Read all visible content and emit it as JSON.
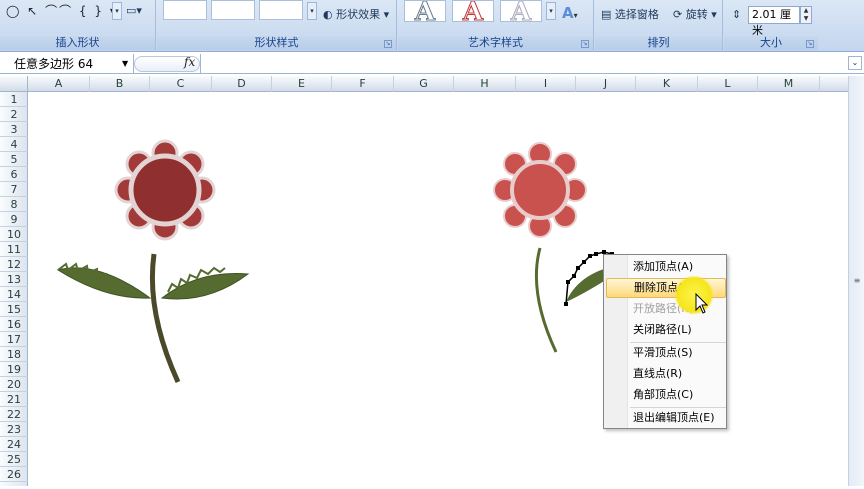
{
  "ribbon": {
    "groups": [
      {
        "label": "插入形状"
      },
      {
        "label": "形状样式"
      },
      {
        "label": "艺术字样式"
      },
      {
        "label": "排列"
      },
      {
        "label": "大小"
      }
    ],
    "shape_effects_label": "形状效果",
    "selection_pane_label": "选择窗格",
    "rotate_label": "旋转",
    "wordart_letter": "A",
    "size_value": "2.01 厘米"
  },
  "formula_bar": {
    "name_box": "任意多边形  64",
    "fx_label": "fx",
    "formula": ""
  },
  "columns": [
    "A",
    "B",
    "C",
    "D",
    "E",
    "F",
    "G",
    "H",
    "I",
    "J",
    "K",
    "L",
    "M"
  ],
  "rows": [
    "1",
    "2",
    "3",
    "4",
    "5",
    "6",
    "7",
    "8",
    "9",
    "10",
    "11",
    "12",
    "13",
    "14",
    "15",
    "16",
    "17",
    "18",
    "19",
    "20",
    "21",
    "22",
    "23",
    "24",
    "25",
    "26"
  ],
  "context_menu": {
    "items": [
      {
        "label": "添加顶点(A)",
        "state": "normal"
      },
      {
        "label": "删除顶点(L)",
        "state": "hover"
      },
      {
        "label": "开放路径(N)",
        "state": "disabled"
      },
      {
        "label": "关闭路径(L)",
        "state": "normal"
      },
      {
        "label": "平滑顶点(S)",
        "state": "normal"
      },
      {
        "label": "直线点(R)",
        "state": "normal"
      },
      {
        "label": "角部顶点(C)",
        "state": "normal"
      },
      {
        "label": "退出编辑顶点(E)",
        "state": "normal"
      }
    ]
  },
  "colors": {
    "flower_left_center": "#8f2f2f",
    "flower_left_petal": "#a33a3a",
    "flower_right": "#c9524f",
    "leaf": "#556b2f",
    "stem": "#4a4a2a",
    "ribbon_bg": "#c4d6ee"
  },
  "icons": [
    "shape-gallery-icon",
    "shape-effects-icon",
    "selection-pane-icon",
    "rotate-icon",
    "height-icon",
    "fx-icon",
    "mouse-cursor-icon"
  ]
}
